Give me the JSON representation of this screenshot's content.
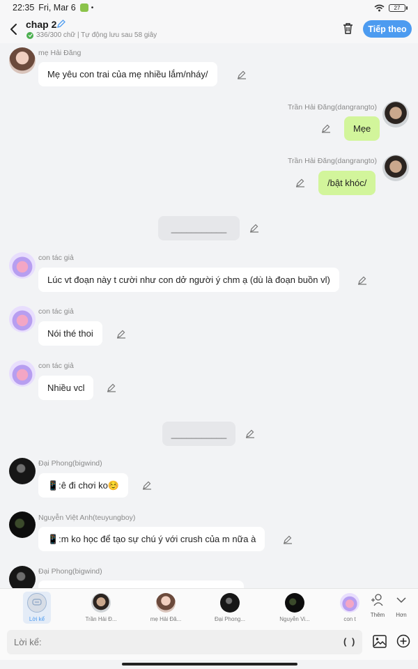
{
  "status_bar": {
    "time": "22:35",
    "date": "Fri, Mar 6",
    "battery": "27"
  },
  "header": {
    "title": "chap 2",
    "subtitle": "336/300 chữ | Tự động lưu sau 58 giây",
    "next_label": "Tiếp theo"
  },
  "messages": [
    {
      "sender": "mẹ Hải Đăng",
      "text": "Mẹ yêu con trai của mẹ nhiều lắm/nháy/"
    },
    {
      "sender": "Trần Hải Đăng(dangrangto)",
      "text": "Mẹe"
    },
    {
      "sender": "Trần Hải Đăng(dangrangto)",
      "text": "/bật khóc/"
    },
    {
      "sender": "",
      "text": "___________"
    },
    {
      "sender": "con tác giả",
      "text": "Lúc vt đoạn này t cười như con dở người ý chm ạ (dù là đoạn buồn vl)"
    },
    {
      "sender": "con tác giả",
      "text": "Nói thé thoi"
    },
    {
      "sender": "con tác giả",
      "text": "Nhiều vcl"
    },
    {
      "sender": "",
      "text": "___________"
    },
    {
      "sender": "Đại Phong(bigwind)",
      "text": "📱:ê đi chơi ko☺️"
    },
    {
      "sender": "Nguyễn Việt Anh(teuyungboy)",
      "text": "📱:m ko học để tạo sự chú ý với crush của m nữa à"
    },
    {
      "sender": "Đại Phong(bigwind)",
      "text": ""
    }
  ],
  "characters": [
    {
      "label": "Lời kể"
    },
    {
      "label": "Trần Hải Đ..."
    },
    {
      "label": "mẹ Hải Đă..."
    },
    {
      "label": "Đại Phong..."
    },
    {
      "label": "Nguyễn Vi..."
    },
    {
      "label": "con t"
    }
  ],
  "side_buttons": {
    "add": "Thêm",
    "more": "Hơn"
  },
  "composer": {
    "placeholder": "Lời kể:",
    "paren": "( )"
  }
}
